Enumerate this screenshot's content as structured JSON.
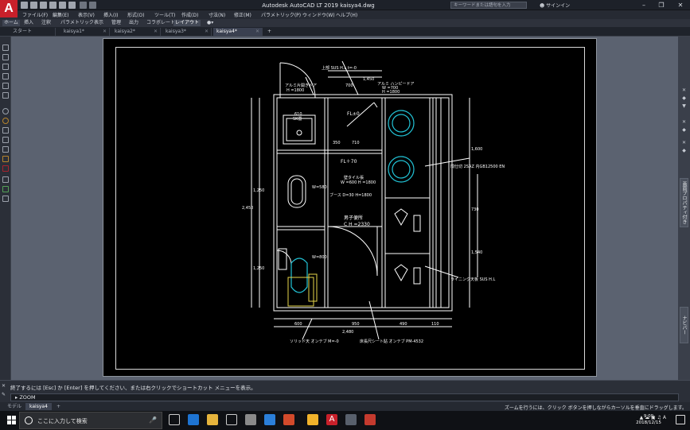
{
  "app": {
    "logo_letter": "A",
    "window_title": "Autodesk AutoCAD LT 2019   kaisya4.dwg",
    "search_placeholder": "キーワードまたは語句を入力",
    "signin": "サインイン"
  },
  "menu": [
    "ファイル(F)",
    "編集(E)",
    "表示(V)",
    "挿入(I)",
    "形式(O)",
    "ツール(T)",
    "作成(D)",
    "寸法(N)",
    "修正(M)",
    "パラメトリック(P)",
    "ウィンドウ(W)",
    "ヘルプ(H)"
  ],
  "ribbon_tabs": [
    "ホーム",
    "挿入",
    "注釈",
    "パラメトリック",
    "表示",
    "管理",
    "出力",
    "コラボレート",
    "レイアウト"
  ],
  "doc_tabs": [
    {
      "label": "スタート"
    },
    {
      "label": "kaisya1*"
    },
    {
      "label": "kaisya2*"
    },
    {
      "label": "kaisya3*"
    },
    {
      "label": "kaisya4*"
    }
  ],
  "drawing": {
    "labels": {
      "top_note": "上部 SUS H.L t=-0",
      "al_door": "アルミ片開きドア",
      "al_door_dim": "H =1800",
      "sk": "SK置",
      "sk_dim": "610",
      "fl0": "FL±0",
      "fl70": "FL＋70",
      "fold_door": "アルミ ハンピードア",
      "fold_door_dim1": "W =700",
      "fold_door_dim2": "H =1800",
      "tile": "壁タイル張",
      "tile_dim": "W =600 H =1800",
      "booth": "ブース D=30 H=1800",
      "room": "男子便所",
      "ch": "C H =2330",
      "partition": "間仕切 2SAZ 内GB12500 EN",
      "lining": "ライニング天板 SUS H.L",
      "floor": "床長尺シート貼 オンテブ PM-4532",
      "urinal": "ソリッド天 オンテブ M=-0",
      "d1": "1,450",
      "d2": "700",
      "d3": "350",
      "d4": "710",
      "d5": "2,450",
      "d6": "1,600",
      "d7": "1,250",
      "d8": "1,250",
      "d9": "730",
      "d10": "1,540",
      "d11": "600",
      "d12": "950",
      "d13": "490",
      "d14": "2,480",
      "d15": "110",
      "d16": "W=580",
      "d17": "W=800"
    }
  },
  "right_panel": {
    "label": "画面プロパティ付き",
    "lower": "ナビバー"
  },
  "command": {
    "history": "終了するには [Esc] か [Enter] を押してください、または右クリックでショートカット メニューを表示。",
    "prompt": "ZOOM"
  },
  "layout_tabs": [
    "モデル",
    "kaisya4"
  ],
  "status_message": "ズームを行うには、クリック ボタンを押しながらカーソルを垂直にドラッグします。",
  "taskbar": {
    "search_placeholder": "ここに入力して検索",
    "time": "9:09",
    "date": "2018/12/15",
    "ime": "A"
  },
  "colors": {
    "cad_bg": "#000000",
    "cad_line": "#ffffff",
    "accent_cyan": "#22c3d6",
    "accent_yellow": "#e6d64a",
    "accent_red": "#c8202a"
  }
}
